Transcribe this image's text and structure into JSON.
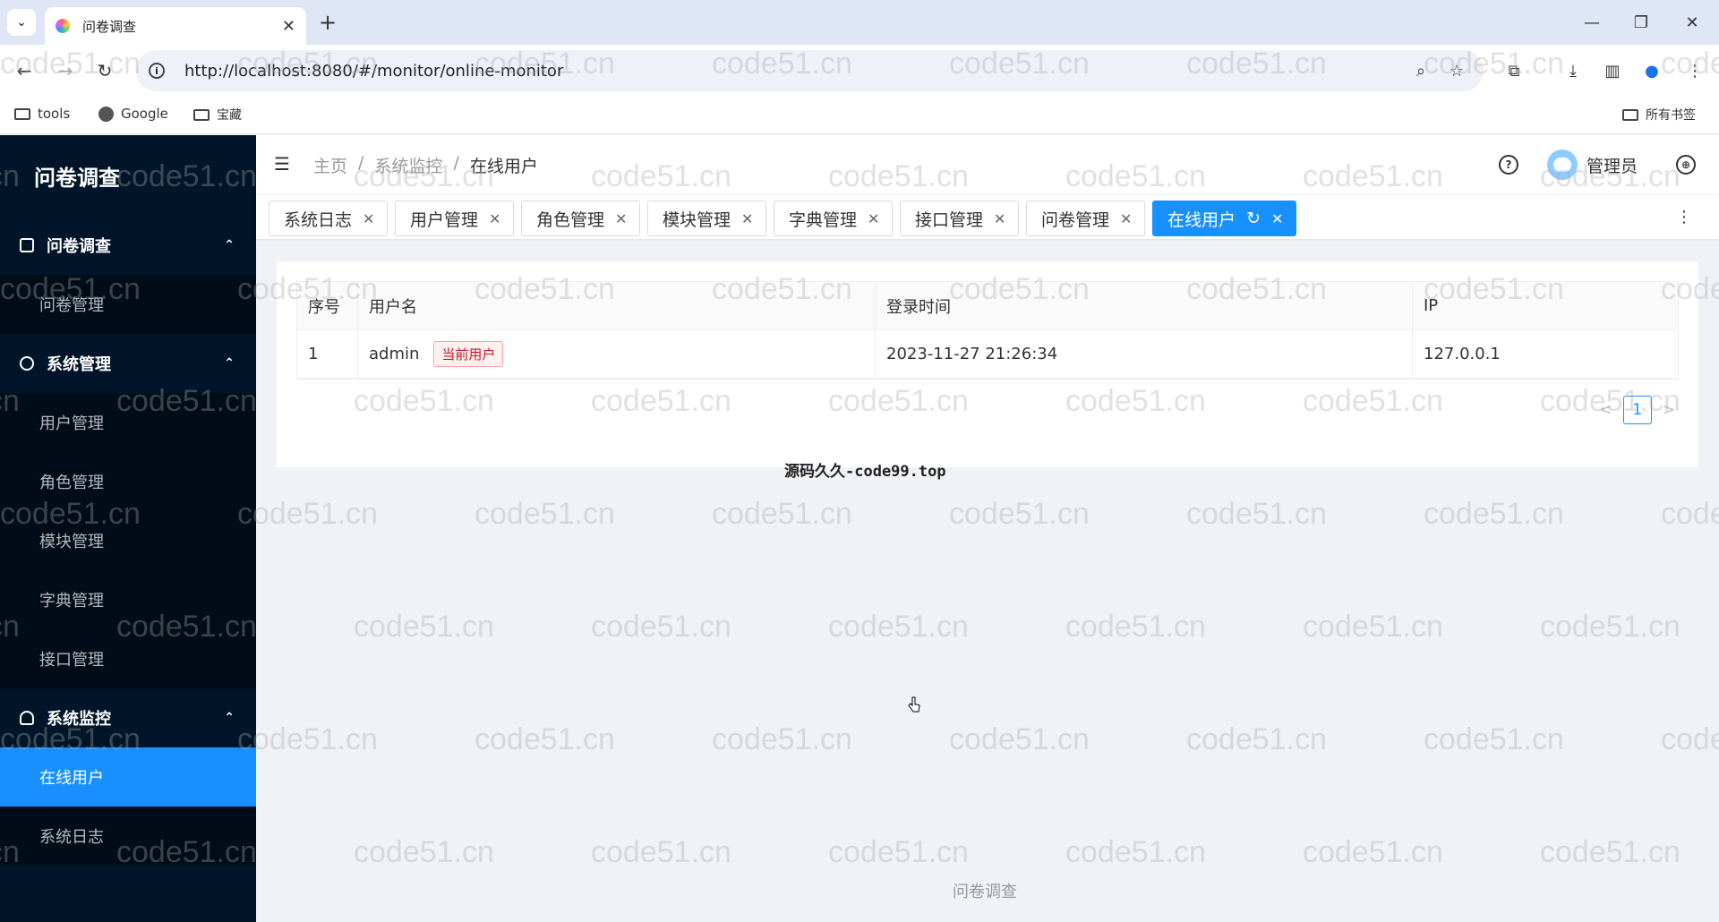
{
  "browser": {
    "tab_title": "问卷调查",
    "url": "http://localhost:8080/#/monitor/online-monitor",
    "bookmarks": [
      "tools",
      "Google",
      "宝藏"
    ],
    "all_bookmarks": "所有书签"
  },
  "app": {
    "logo": "问卷调查",
    "sidebar": {
      "groups": [
        {
          "label": "问卷调查",
          "items": [
            "问卷管理"
          ]
        },
        {
          "label": "系统管理",
          "items": [
            "用户管理",
            "角色管理",
            "模块管理",
            "字典管理",
            "接口管理"
          ]
        },
        {
          "label": "系统监控",
          "items": [
            "在线用户",
            "系统日志"
          ]
        }
      ],
      "active_item": "在线用户"
    },
    "breadcrumb": [
      "主页",
      "系统监控",
      "在线用户"
    ],
    "breadcrumb_sep": "/",
    "user_name": "管理员",
    "tags": [
      "系统日志",
      "用户管理",
      "角色管理",
      "模块管理",
      "字典管理",
      "接口管理",
      "问卷管理",
      "在线用户"
    ],
    "active_tag": "在线用户"
  },
  "table": {
    "columns": [
      "序号",
      "用户名",
      "登录时间",
      "IP"
    ],
    "rows": [
      {
        "index": "1",
        "username": "admin",
        "badge": "当前用户",
        "login_time": "2023-11-27 21:26:34",
        "ip": "127.0.0.1"
      }
    ]
  },
  "pagination": {
    "current_page": "1",
    "prev": "<",
    "next": ">"
  },
  "note": "源码久久-code99.top",
  "footer": "问卷调查",
  "watermark": "code51.cn"
}
